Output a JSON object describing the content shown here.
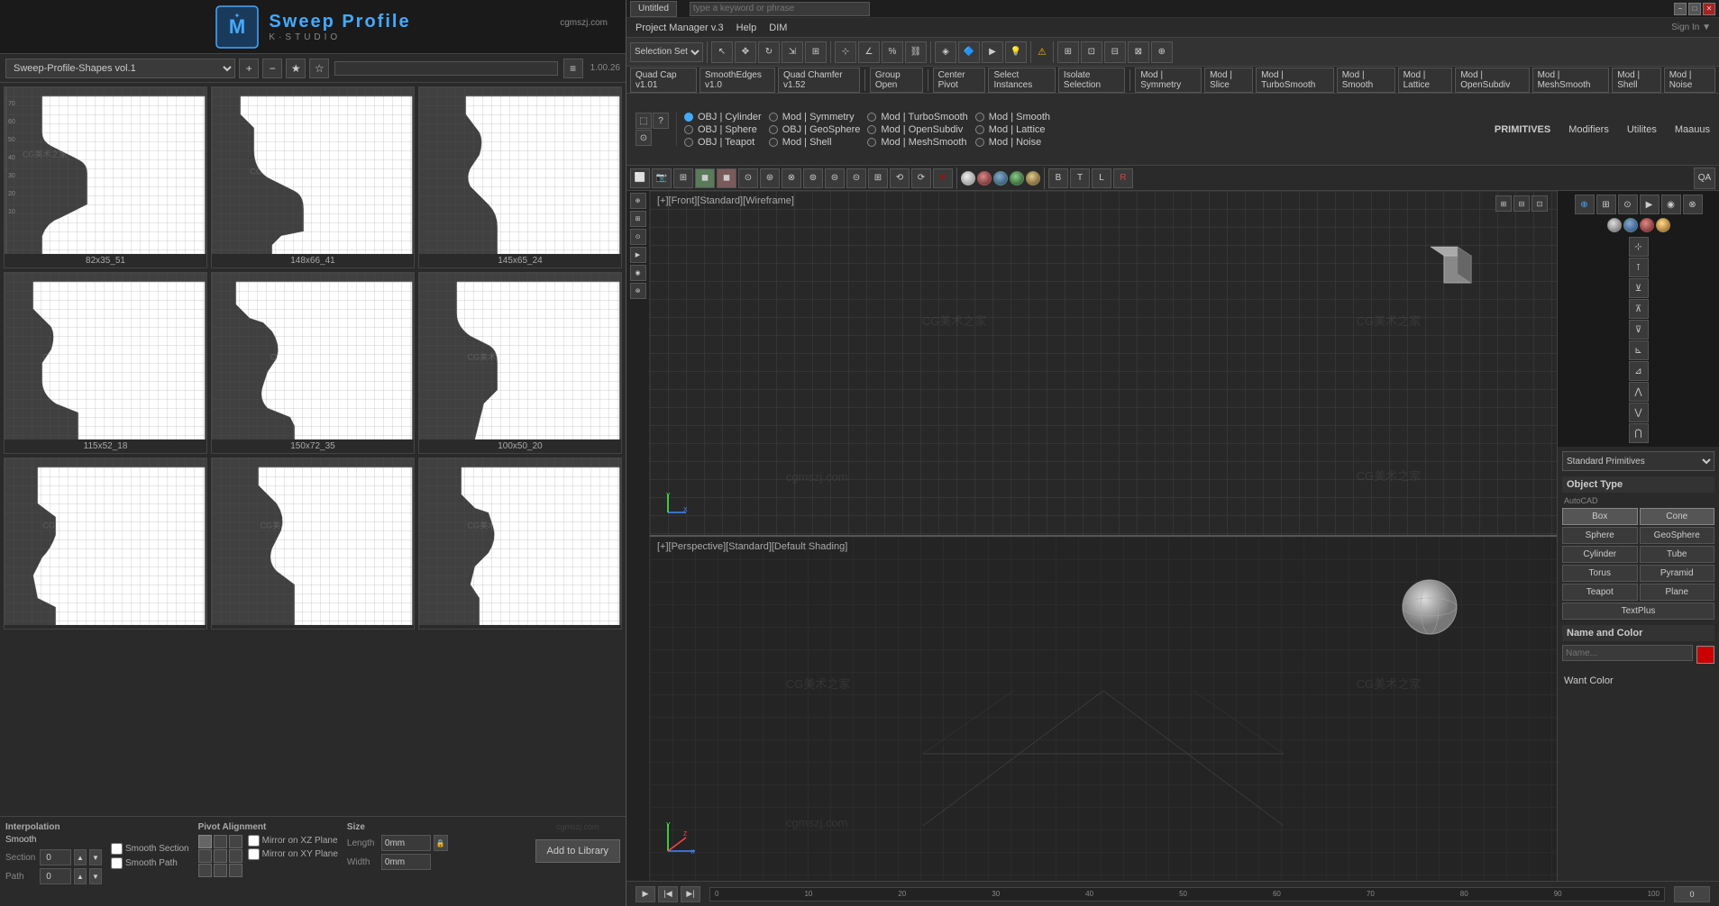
{
  "app": {
    "title": "Sweep Profile",
    "subtitle": "K·STUDIO",
    "domain": "cgmszj.com",
    "version": "1.00.26"
  },
  "left_panel": {
    "dropdown": "Sweep-Profile-Shapes vol.1",
    "thumbnails": [
      {
        "label": "82x35_51",
        "shape": "crown1"
      },
      {
        "label": "148x66_41",
        "shape": "crown2"
      },
      {
        "label": "145x65_24",
        "shape": "crown3"
      },
      {
        "label": "115x52_18",
        "shape": "crown4"
      },
      {
        "label": "150x72_35",
        "shape": "crown5"
      },
      {
        "label": "100x50_20",
        "shape": "crown6"
      },
      {
        "label": "",
        "shape": "crown7"
      },
      {
        "label": "",
        "shape": "crown8"
      },
      {
        "label": "",
        "shape": "crown9"
      }
    ]
  },
  "bottom_controls": {
    "interpolation_label": "Interpolation",
    "smooth_label": "Smooth",
    "section_label": "Section",
    "section_value": "0",
    "path_label": "Path",
    "path_value": "0",
    "smooth_section": "Smooth Section",
    "smooth_path": "Smooth Path",
    "pivot_label": "Pivot Alignment",
    "mirror_xz": "Mirror on XZ Plane",
    "mirror_xy": "Mirror on XY Plane",
    "size_label": "Size",
    "length_label": "Length",
    "length_value": "0mm",
    "width_label": "Width",
    "width_value": "0mm",
    "add_btn": "Add to Library"
  },
  "max": {
    "title": "Untitled",
    "menu_items": [
      "Project Manager v.3",
      "Help",
      "DIM"
    ],
    "primitives_label": "PRIMITIVES",
    "modifiers_label": "Modifiers",
    "utilities_label": "Utilites",
    "maauus_label": "Maauus",
    "viewport_front_label": "[+][Front][Standard][Wireframe]",
    "viewport_persp_label": "[+][Perspective][Standard][Default Shading]",
    "watermarks": [
      "CG美术之家",
      "cgmszj.com"
    ],
    "obj_types": [
      "Box",
      "Cone",
      "Sphere",
      "GeoSphere",
      "Cylinder",
      "Tube",
      "Torus",
      "Pyramid",
      "Teapot",
      "Plane",
      "TextPlus"
    ],
    "name_color_label": "Name and Color",
    "object_type_label": "Object Type",
    "standard_primitives": "Standard Primitives",
    "properties_header": "▼",
    "plugins": [
      "SmoothEdges v1.0",
      "Quad Cap v1.01",
      "Quad Chamfer v1.52",
      "Group Open",
      "Center Pivot",
      "Select Instances",
      "Isolate Selection",
      "Mod | Symmetry",
      "Mod | Slice",
      "Mod | TurboSmooth",
      "Mod | Smooth",
      "Mod | Lattice",
      "Mod | MeshSmooth",
      "Mod | Shell",
      "Mod | OpenSubdiv"
    ],
    "timeline": {
      "start": "0",
      "values": [
        "0",
        "10",
        "20",
        "30",
        "40",
        "50",
        "60",
        "70",
        "80",
        "90",
        "100"
      ]
    }
  },
  "icons": {
    "add": "+",
    "subtract": "−",
    "star": "★",
    "star_empty": "☆",
    "gear": "⚙",
    "list": "≡",
    "pin": "📌",
    "lock": "🔒",
    "eye": "👁",
    "move": "↔",
    "rotate": "↻",
    "scale": "⇲",
    "link": "🔗",
    "close": "✕",
    "minimize": "−",
    "maximize": "□",
    "arrow_down": "▼",
    "arrow_right": "▶",
    "check": "✓",
    "cube": "◼"
  }
}
